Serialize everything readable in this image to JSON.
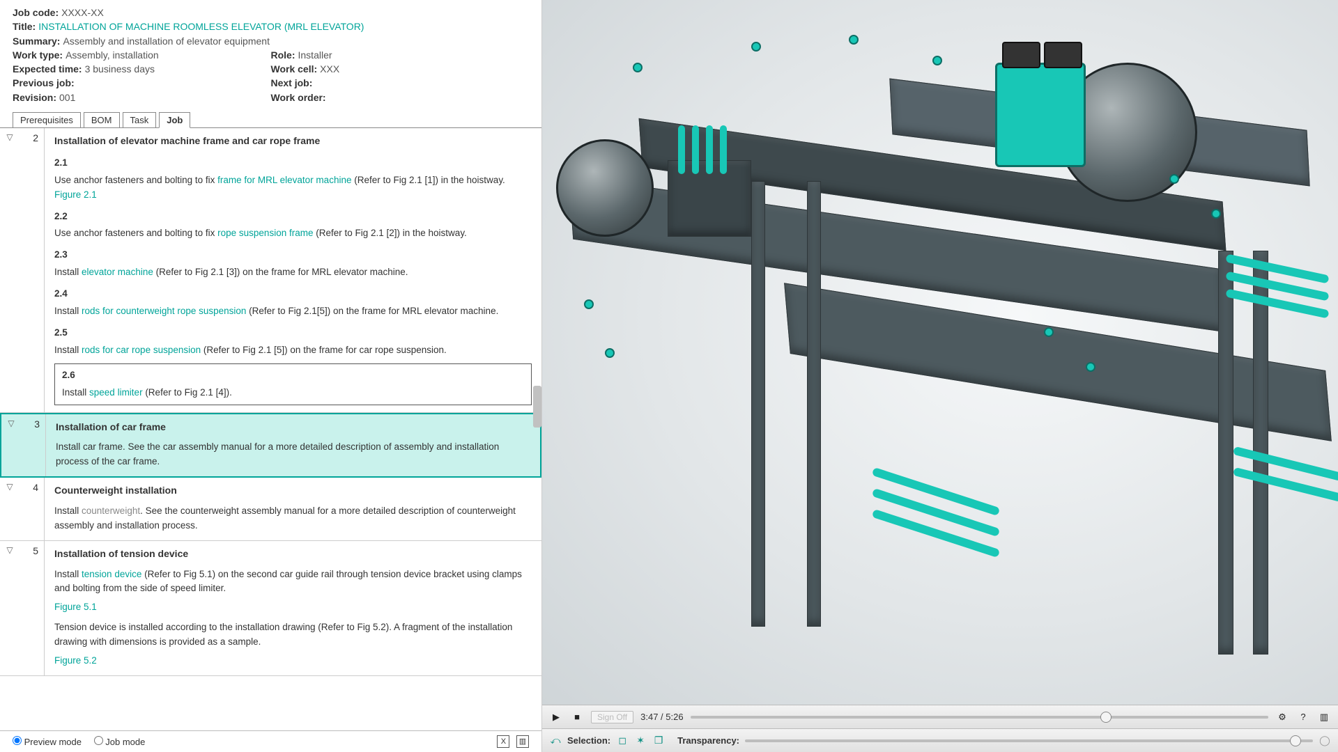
{
  "meta": {
    "jobcode_label": "Job code:",
    "jobcode": "XXXX-XX",
    "title_label": "Title:",
    "title": "INSTALLATION OF MACHINE ROOMLESS ELEVATOR (MRL ELEVATOR)",
    "summary_label": "Summary:",
    "summary": "Assembly and installation of elevator equipment",
    "worktype_label": "Work type:",
    "worktype": "Assembly, installation",
    "role_label": "Role:",
    "role": "Installer",
    "expected_label": "Expected time:",
    "expected": "3 business days",
    "workcell_label": "Work cell:",
    "workcell": "XXX",
    "prevjob_label": "Previous job:",
    "prevjob": "",
    "nextjob_label": "Next job:",
    "nextjob": "",
    "revision_label": "Revision:",
    "revision": "001",
    "workorder_label": "Work order:",
    "workorder": ""
  },
  "tabs": {
    "prereq": "Prerequisites",
    "bom": "BOM",
    "task": "Task",
    "job": "Job"
  },
  "steps": {
    "s2": {
      "num": "2",
      "heading": "Installation of elevator machine frame and car rope frame",
      "s21_num": "2.1",
      "s21_a": "Use anchor fasteners and bolting to fix ",
      "s21_link": "frame for MRL elevator machine",
      "s21_b": " (Refer to Fig 2.1 [1]) in the hoistway.",
      "fig21": "Figure 2.1",
      "s22_num": "2.2",
      "s22_a": "Use anchor fasteners and bolting to fix ",
      "s22_link": "rope suspension frame",
      "s22_b": " (Refer to Fig 2.1 [2]) in the hoistway.",
      "s23_num": "2.3",
      "s23_a": "Install ",
      "s23_link": "elevator machine",
      "s23_b": " (Refer to Fig 2.1 [3]) on the frame for MRL elevator machine.",
      "s24_num": "2.4",
      "s24_a": "Install ",
      "s24_link": "rods for counterweight rope suspension",
      "s24_b": " (Refer to Fig 2.1[5]) on the frame for MRL elevator machine.",
      "s25_num": "2.5",
      "s25_a": "Install ",
      "s25_link": "rods for car rope suspension",
      "s25_b": " (Refer to Fig 2.1 [5]) on the frame for car rope suspension.",
      "s26_num": "2.6",
      "s26_a": "Install ",
      "s26_link": "speed limiter",
      "s26_b": " (Refer to Fig 2.1 [4])."
    },
    "s3": {
      "num": "3",
      "heading": "Installation of car frame",
      "body": "Install car frame. See the car assembly manual for a more detailed description of assembly and installation process of the car frame."
    },
    "s4": {
      "num": "4",
      "heading": "Counterweight installation",
      "body_a": "Install ",
      "body_link": "counterweight",
      "body_b": ". See the counterweight assembly manual for a more detailed description of counterweight assembly and installation process."
    },
    "s5": {
      "num": "5",
      "heading": "Installation of tension device",
      "p1_a": "Install ",
      "p1_link": "tension device",
      "p1_b": " (Refer to Fig 5.1) on the second car guide rail through tension device bracket using clamps and bolting from the side of speed limiter.",
      "fig51": "Figure 5.1",
      "p2": "Tension device is installed according to the installation drawing (Refer to Fig 5.2). A fragment of the installation drawing with dimensions is provided as a sample.",
      "fig52": "Figure 5.2"
    }
  },
  "footer": {
    "preview": "Preview mode",
    "job": "Job mode"
  },
  "player": {
    "signoff": "Sign Off",
    "time": "3:47 / 5:26",
    "selection_label": "Selection:",
    "transparency_label": "Transparency:"
  },
  "gutter_tri": "▽"
}
